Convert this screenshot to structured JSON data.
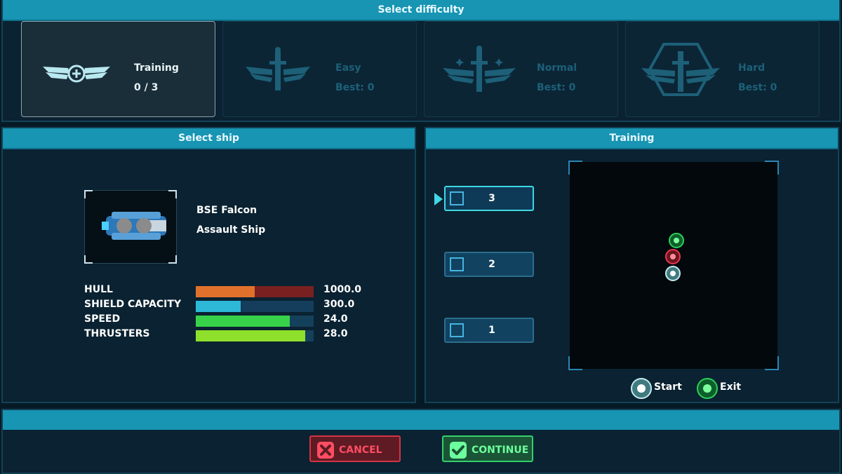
{
  "difficulty": {
    "title": "Select difficulty",
    "options": [
      {
        "name": "Training",
        "sub": "0 / 3",
        "state": "selected",
        "icon": "winged-badge-icon"
      },
      {
        "name": "Easy",
        "sub": "Best: 0",
        "state": "locked",
        "icon": "winged-sword-icon"
      },
      {
        "name": "Normal",
        "sub": "Best: 0",
        "state": "locked",
        "icon": "winged-sword-stars-icon"
      },
      {
        "name": "Hard",
        "sub": "Best: 0",
        "state": "locked",
        "icon": "hexagon-winged-sword-icon"
      }
    ]
  },
  "ship": {
    "title": "Select ship",
    "name": "BSE Falcon",
    "class": "Assault Ship",
    "stats": [
      {
        "label": "HULL",
        "value": "1000.0",
        "fill": 0.5,
        "color": "#e0712c",
        "track": "#7a2020"
      },
      {
        "label": "SHIELD CAPACITY",
        "value": "300.0",
        "fill": 0.38,
        "color": "#2db8d8",
        "track": "#143e5c"
      },
      {
        "label": "SPEED",
        "value": "24.0",
        "fill": 0.8,
        "color": "#38d24a",
        "track": "#14405c"
      },
      {
        "label": "THRUSTERS",
        "value": "28.0",
        "fill": 0.93,
        "color": "#8ee02a",
        "track": "#14405c"
      }
    ]
  },
  "training": {
    "title": "Training",
    "stages": [
      {
        "label": "3",
        "active": true
      },
      {
        "label": "2",
        "active": false
      },
      {
        "label": "1",
        "active": false
      }
    ],
    "legend": {
      "start": "Start",
      "exit": "Exit"
    }
  },
  "actions": {
    "cancel": "CANCEL",
    "continue": "CONTINUE"
  },
  "colors": {
    "accent": "#1795b3",
    "cancel": "#d33545",
    "continue": "#35d06c"
  }
}
